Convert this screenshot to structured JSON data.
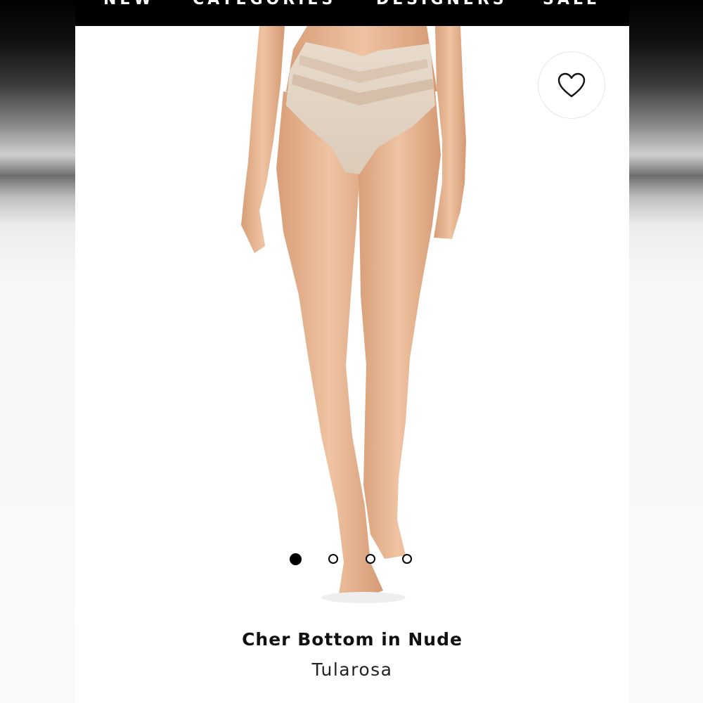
{
  "nav": {
    "items": [
      "NEW",
      "CATEGORIES",
      "DESIGNERS",
      "SALE"
    ]
  },
  "product": {
    "name": "Cher Bottom in Nude",
    "brand": "Tularosa"
  },
  "wishlist": {
    "icon": "heart-icon"
  },
  "carousel": {
    "total": 4,
    "active_index": 0
  },
  "colors": {
    "nav_bg": "#000000",
    "nav_text": "#ffffff",
    "skin": "#e8b896",
    "garment": "#e3d4c4"
  }
}
